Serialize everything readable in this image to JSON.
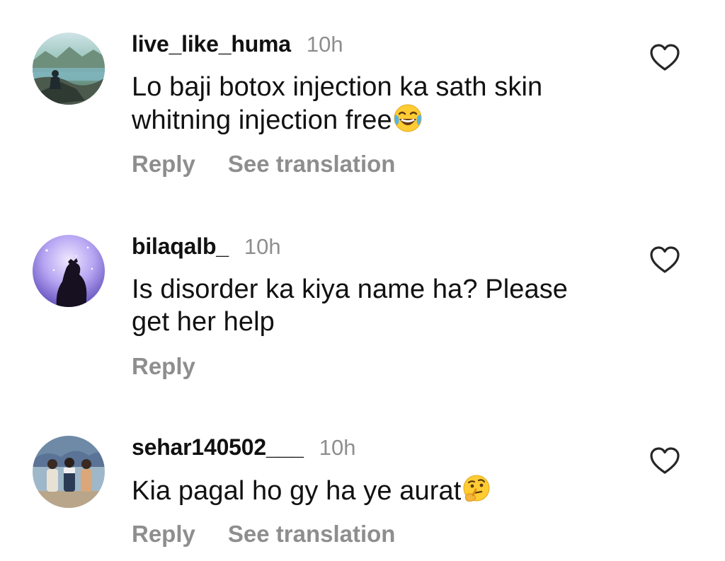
{
  "comments": [
    {
      "username": "live_like_huma",
      "time": "10h",
      "text": "Lo baji botox injection ka sath skin whitning injection free",
      "text_line1": "Lo baji botox injection ka sath skin",
      "text_line2": "whitning injection free",
      "emoji": "face-with-tears-of-joy",
      "actions": [
        "Reply",
        "See translation"
      ],
      "like_icon": "heart-outline-icon"
    },
    {
      "username": "bilaqalb_",
      "time": "10h",
      "text": "Is disorder ka kiya name ha? Please get her help",
      "text_line1": "Is disorder ka kiya name ha? Please",
      "text_line2": "get her help",
      "actions": [
        "Reply"
      ],
      "like_icon": "heart-outline-icon"
    },
    {
      "username": "sehar140502___",
      "time": "10h",
      "text": "Kia pagal ho gy ha ye aurat",
      "text_line1": "Kia pagal ho gy ha ye aurat",
      "emoji": "thinking-face",
      "actions": [
        "Reply",
        "See translation"
      ],
      "like_icon": "heart-outline-icon"
    }
  ],
  "colors": {
    "primary_text": "#111111",
    "secondary_text": "#8e8e8e",
    "background": "#ffffff"
  }
}
